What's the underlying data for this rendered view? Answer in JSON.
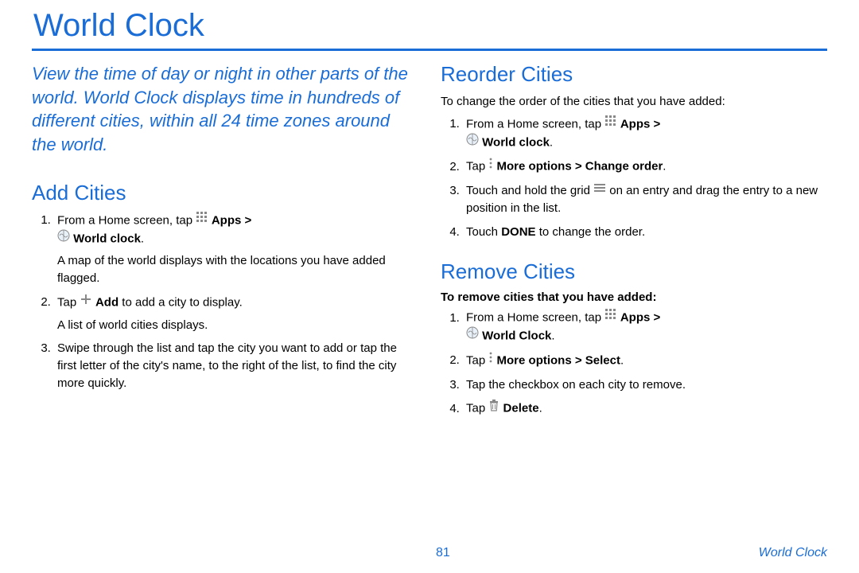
{
  "title": "World Clock",
  "intro": "View the time of day or night in other parts of the world. World Clock displays time in hundreds of different cities, within all 24 time zones around the world.",
  "add": {
    "heading": "Add Cities",
    "step1_a": "From a Home screen, tap ",
    "step1_apps": " Apps > ",
    "step1_wc": " World clock",
    "step1_end": ".",
    "step1_body": "A map of the world displays with the locations you have added flagged.",
    "step2_a": "Tap ",
    "step2_add": " Add",
    "step2_b": " to add a city to display.",
    "step2_body": "A list of world cities displays.",
    "step3": "Swipe through the list and tap the city you want to add or tap the first letter of the city's name, to the right of the list, to find the city more quickly."
  },
  "reorder": {
    "heading": "Reorder Cities",
    "intro": "To change the order of the cities that you have added:",
    "step1_a": "From a Home screen, tap ",
    "step1_apps": " Apps > ",
    "step1_wc": " World clock",
    "step1_end": ".",
    "step2_a": "Tap ",
    "step2_more": " More options > Change order",
    "step2_end": ".",
    "step3_a": "Touch and hold the grid ",
    "step3_b": " on an entry and drag the entry to a new position in the list.",
    "step4_a": "Touch ",
    "step4_done": "DONE",
    "step4_b": " to change the order."
  },
  "remove": {
    "heading": "Remove Cities",
    "sub": "To remove cities that you have added:",
    "step1_a": "From a Home screen, tap ",
    "step1_apps": " Apps > ",
    "step1_wc": " World Clock",
    "step1_end": ".",
    "step2_a": "Tap ",
    "step2_more": " More options > Select",
    "step2_end": ".",
    "step3": "Tap the checkbox on each city to remove.",
    "step4_a": "Tap ",
    "step4_del": " Delete",
    "step4_end": "."
  },
  "footer": {
    "page": "81",
    "label": "World Clock"
  }
}
